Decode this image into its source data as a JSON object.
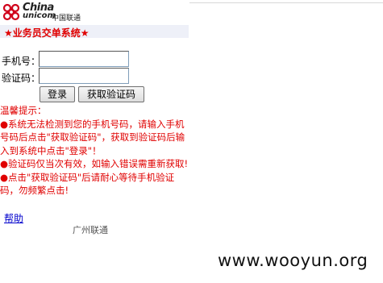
{
  "logo": {
    "english_top": "China",
    "english_bottom": "unicom",
    "chinese": "中国联通"
  },
  "system_title": "★业务员交单系统★",
  "form": {
    "phone_label": "手机号：",
    "phone_value": "",
    "code_label": "验证码：",
    "code_value": "",
    "login_button": "登录",
    "get_code_button": "获取验证码"
  },
  "tips": {
    "header": "温馨提示：",
    "items": [
      "●系统无法检测到您的手机号码，请输入手机号码后点击\"获取验证码\"，获取到验证码后输入到系统中点击\"登录\"！",
      "●验证码仅当次有效，如输入错误需重新获取!",
      "●点击\"获取验证码\"后请耐心等待手机验证码，勿频繁点击!"
    ]
  },
  "help_link": "帮助",
  "footer": "广州联通",
  "watermark": "www.wooyun.org",
  "colors": {
    "accent": "#e00000",
    "link": "#0000cc",
    "bar_bg": "#eef0f8"
  }
}
